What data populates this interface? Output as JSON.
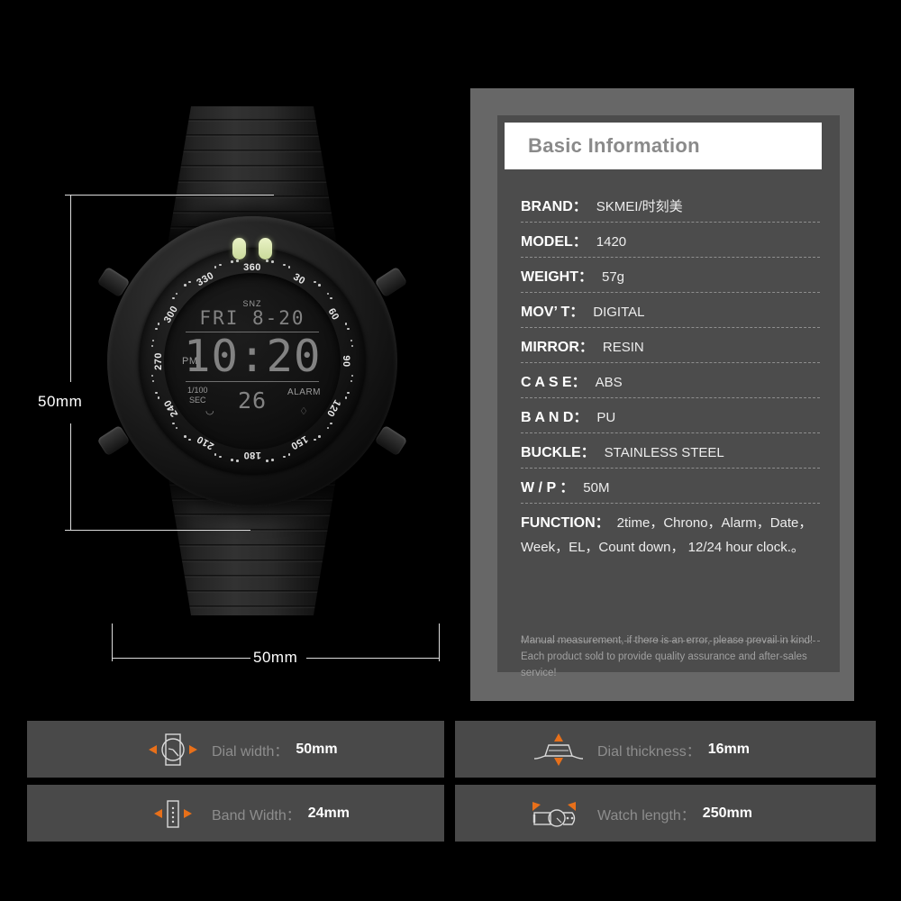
{
  "product_image": {
    "watch": {
      "bezel_numbers": [
        "360",
        "30",
        "60",
        "90",
        "120",
        "150",
        "180",
        "210",
        "240",
        "270",
        "300",
        "330"
      ],
      "lcd": {
        "snz": "SNZ",
        "date_line": "FRI 8-20",
        "pm": "PM",
        "time": "10:20",
        "sub_left_line1": "1/100",
        "sub_left_line2": "SEC",
        "counter": "26",
        "alarm": "ALARM"
      }
    },
    "dimensions": {
      "height_label": "50mm",
      "width_label": "50mm"
    }
  },
  "spec_panel": {
    "title": "Basic Information",
    "rows": [
      {
        "label": "BRAND：",
        "value": "SKMEI/时刻美"
      },
      {
        "label": "MODEL：",
        "value": "1420"
      },
      {
        "label": "WEIGHT：",
        "value": "57g"
      },
      {
        "label": "MOV’ T：",
        "value": "DIGITAL"
      },
      {
        "label": "MIRROR：",
        "value": "RESIN"
      },
      {
        "label": "C A S E：",
        "value": "ABS"
      },
      {
        "label": "B A N D：",
        "value": "PU"
      },
      {
        "label": "BUCKLE：",
        "value": "STAINLESS STEEL"
      },
      {
        "label": "W / P  ：",
        "value": "50M"
      }
    ],
    "function": {
      "label": "FUNCTION：",
      "value_line1": "2time，Chrono，Alarm，Date，",
      "value_line2": "Week，EL，Count down， 12/24 hour clock.。"
    },
    "note_line1": "Manual measurement, if there is an error, please prevail in kind!",
    "note_line2": "Each product sold to provide quality assurance and after-sales service!"
  },
  "info_boxes": [
    {
      "icon": "watch-face-icon",
      "label": "Dial width：",
      "value": "50mm"
    },
    {
      "icon": "band-width-icon",
      "label": "Band Width：",
      "value": "24mm"
    },
    {
      "icon": "dial-thickness-icon",
      "label": "Dial thickness：",
      "value": "16mm"
    },
    {
      "icon": "watch-length-icon",
      "label": "Watch length：",
      "value": "250mm"
    }
  ],
  "colors": {
    "background": "#000000",
    "panel_outer": "#676767",
    "panel_inner": "#4c4c4c",
    "box": "#494949",
    "accent_orange": "#e8701a",
    "label_gray": "#8d8d8d"
  }
}
